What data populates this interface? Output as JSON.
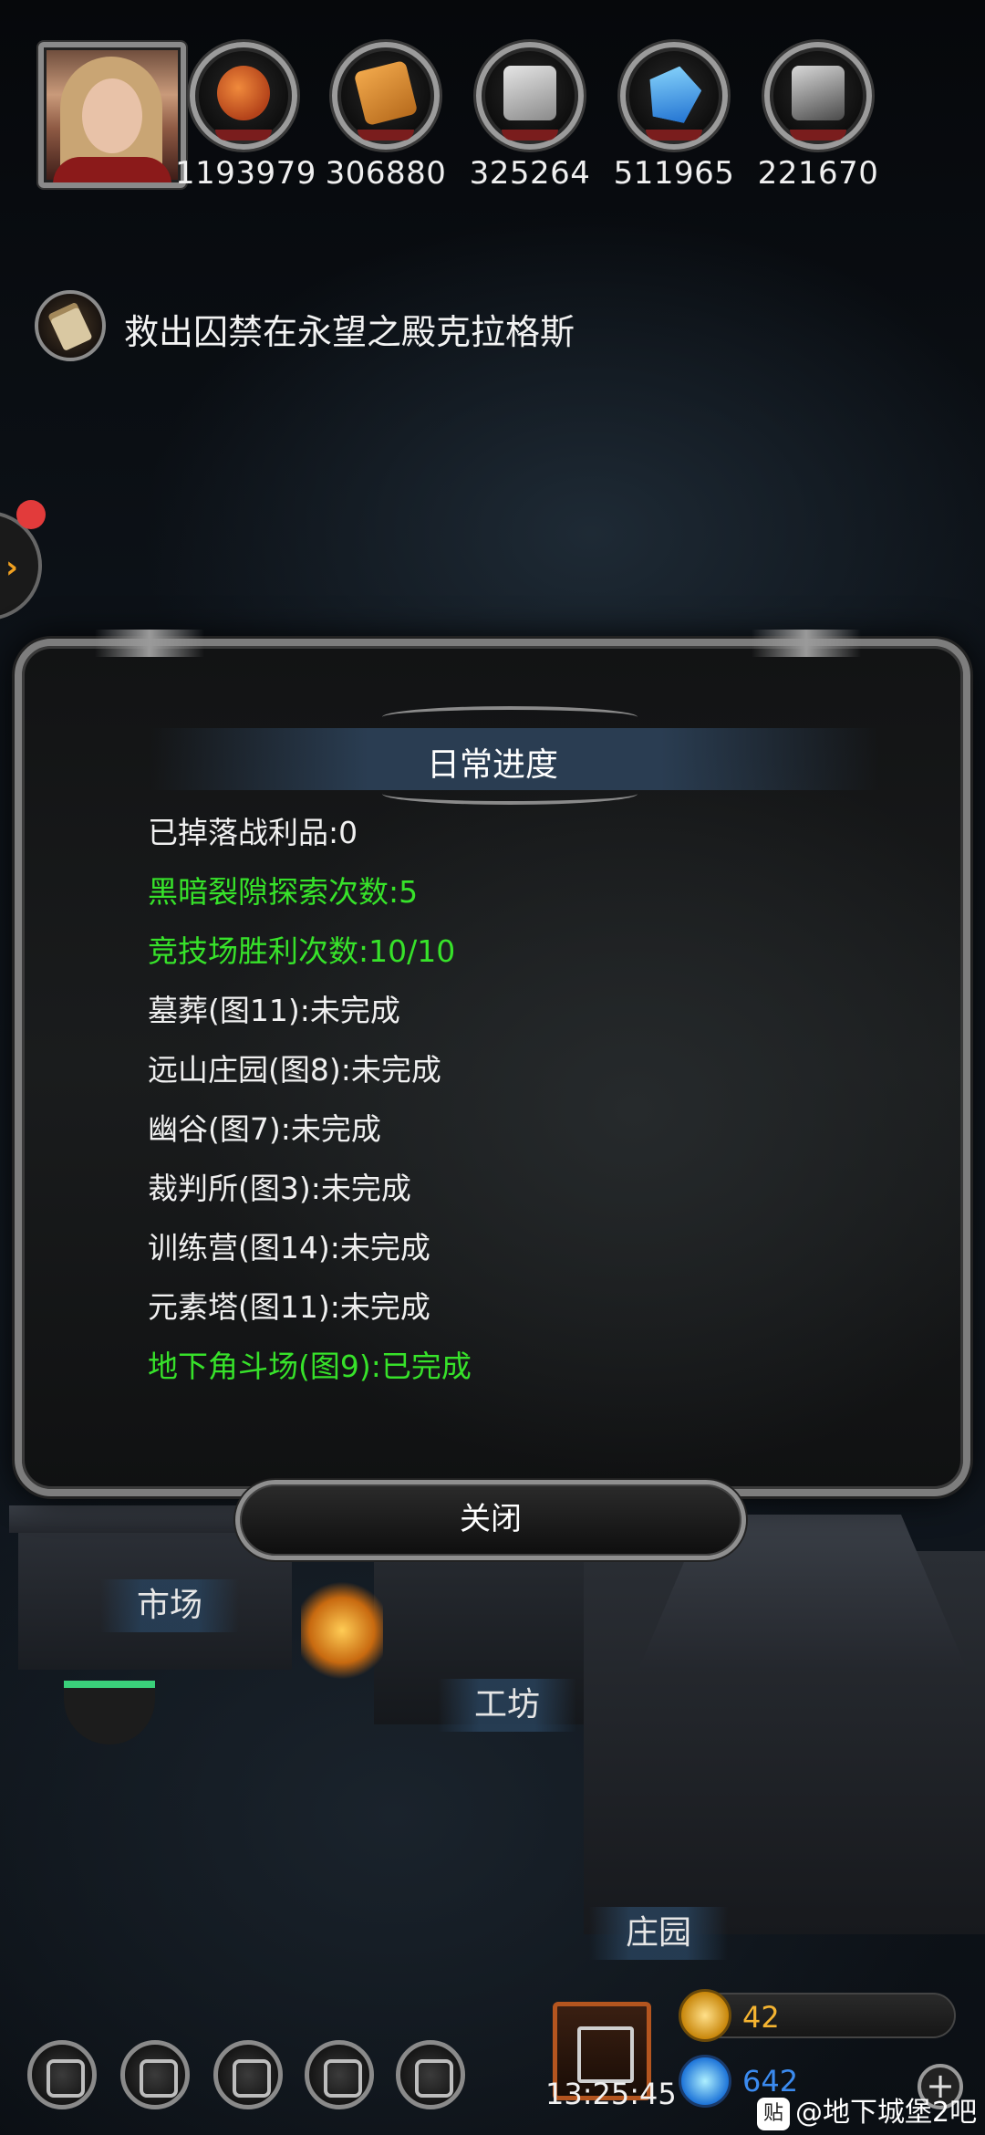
{
  "resources": [
    {
      "icon": "meat-icon",
      "value": "1193979"
    },
    {
      "icon": "wood-icon",
      "value": "306880"
    },
    {
      "icon": "iron-icon",
      "value": "325264"
    },
    {
      "icon": "crystal-icon",
      "value": "511965"
    },
    {
      "icon": "steel-icon",
      "value": "221670"
    }
  ],
  "quest": {
    "text": "救出囚禁在永望之殿克拉格斯"
  },
  "dialog": {
    "title": "日常进度",
    "lines": [
      {
        "text": "已掉落战利品:0",
        "status": "normal"
      },
      {
        "text": "黑暗裂隙探索次数:5",
        "status": "done"
      },
      {
        "text": "竞技场胜利次数:10/10",
        "status": "done"
      },
      {
        "text": "墓葬(图11):未完成",
        "status": "normal"
      },
      {
        "text": "远山庄园(图8):未完成",
        "status": "normal"
      },
      {
        "text": "幽谷(图7):未完成",
        "status": "normal"
      },
      {
        "text": "裁判所(图3):未完成",
        "status": "normal"
      },
      {
        "text": "训练营(图14):未完成",
        "status": "normal"
      },
      {
        "text": "元素塔(图11):未完成",
        "status": "normal"
      },
      {
        "text": "地下角斗场(图9):已完成",
        "status": "done"
      }
    ],
    "close_label": "关闭"
  },
  "town": {
    "market_label": "市场",
    "workshop_label": "工坊",
    "manor_label": "庄园"
  },
  "bottom": {
    "time": "13:25:45",
    "gold_value": "42",
    "gem_value": "642",
    "plus_label": "+",
    "watermark_badge": "贴",
    "watermark_text": "@地下城堡2吧"
  },
  "colors": {
    "done_text": "#37e22a",
    "normal_text": "#f0f0f0",
    "gold": "#f5b431",
    "gem": "#3b8bf0"
  }
}
